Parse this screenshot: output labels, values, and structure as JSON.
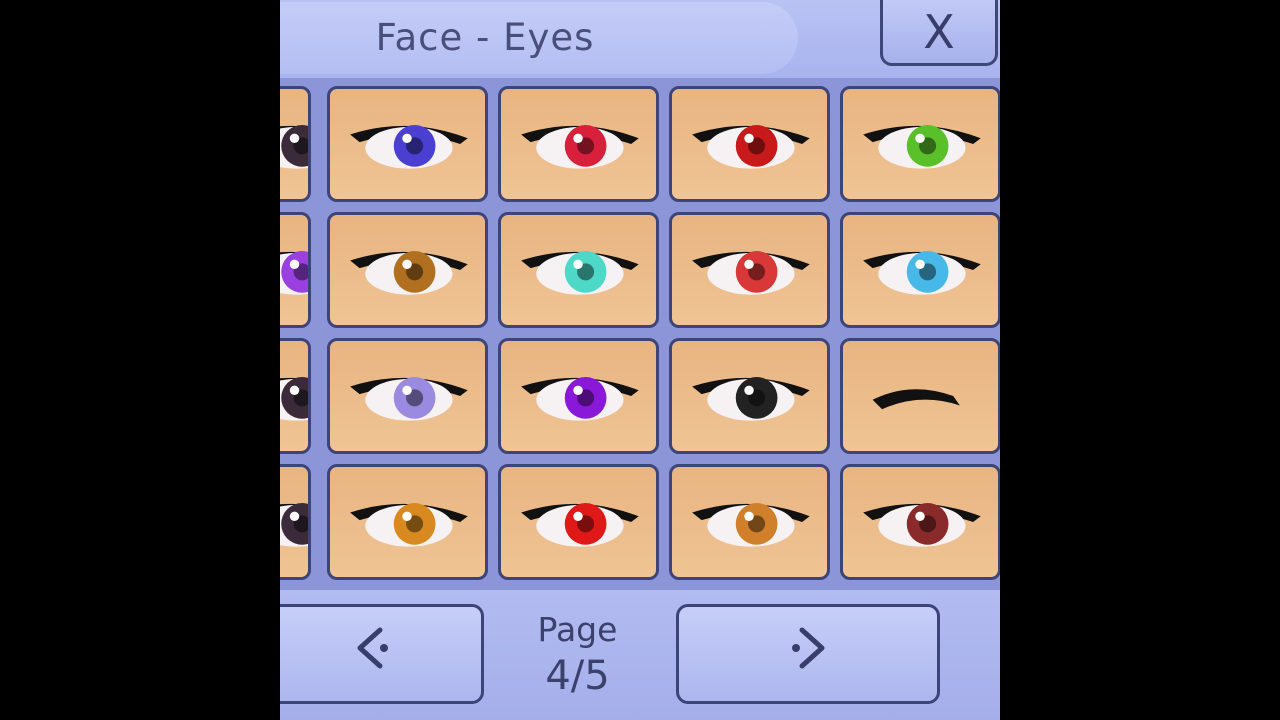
{
  "header": {
    "title": "Face - Eyes",
    "close_label": "X"
  },
  "grid": {
    "rows": [
      [
        "partial-eye",
        "blue-star-eye",
        "red-target-eye",
        "red-yellow-eye",
        "green-eye"
      ],
      [
        "partial-purple-eye",
        "brown-eye",
        "teal-heart-eye",
        "red-cross-eye",
        "light-blue-eye"
      ],
      [
        "partial-eye",
        "lilac-plaid-eye",
        "purple-star-eye",
        "spiral-eye",
        "closed-eye"
      ],
      [
        "partial-eye",
        "amber-eye",
        "red-eye",
        "amber-round-eye",
        "dark-red-heart-eye"
      ]
    ]
  },
  "pager": {
    "prev_label": "<",
    "next_label": ">",
    "page_label": "Page",
    "page_value": "4/5"
  }
}
